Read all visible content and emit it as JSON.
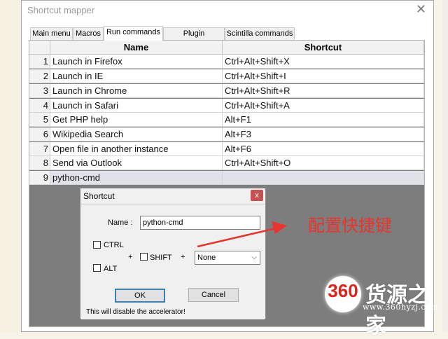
{
  "window": {
    "title": "Shortcut mapper",
    "close_glyph": "✕"
  },
  "tabs": [
    {
      "label": "Main menu",
      "active": false
    },
    {
      "label": "Macros",
      "active": false
    },
    {
      "label": "Run commands",
      "active": true
    },
    {
      "label": "Plugin commands",
      "active": false
    },
    {
      "label": "Scintilla commands",
      "active": false
    }
  ],
  "grid": {
    "headers": {
      "name": "Name",
      "shortcut": "Shortcut"
    },
    "rows": [
      {
        "num": "1",
        "name": "Launch in Firefox",
        "shortcut": "Ctrl+Alt+Shift+X"
      },
      {
        "num": "2",
        "name": "Launch in IE",
        "shortcut": "Ctrl+Alt+Shift+I"
      },
      {
        "num": "3",
        "name": "Launch in Chrome",
        "shortcut": "Ctrl+Alt+Shift+R"
      },
      {
        "num": "4",
        "name": "Launch in Safari",
        "shortcut": "Ctrl+Alt+Shift+A"
      },
      {
        "num": "5",
        "name": "Get PHP help",
        "shortcut": "Alt+F1"
      },
      {
        "num": "6",
        "name": "Wikipedia Search",
        "shortcut": "Alt+F3"
      },
      {
        "num": "7",
        "name": "Open file in another instance",
        "shortcut": "Alt+F6"
      },
      {
        "num": "8",
        "name": "Send via Outlook",
        "shortcut": "Ctrl+Alt+Shift+O"
      },
      {
        "num": "9",
        "name": "python-cmd",
        "shortcut": ""
      }
    ]
  },
  "dialog": {
    "title": "Shortcut",
    "close_glyph": "x",
    "name_label": "Name :",
    "name_value": "python-cmd",
    "ctrl_label": "CTRL",
    "alt_label": "ALT",
    "plus1": "+",
    "shift_label": "SHIFT",
    "plus2": "+",
    "key_value": "None",
    "ok_label": "OK",
    "cancel_label": "Cancel",
    "note": "This will disable the accelerator!"
  },
  "annotation": {
    "text": "配置快捷键",
    "color": "#e5352e"
  },
  "watermark": {
    "logo_number": "360",
    "brand": "货源之家",
    "url": "www.360hyzj.com"
  }
}
